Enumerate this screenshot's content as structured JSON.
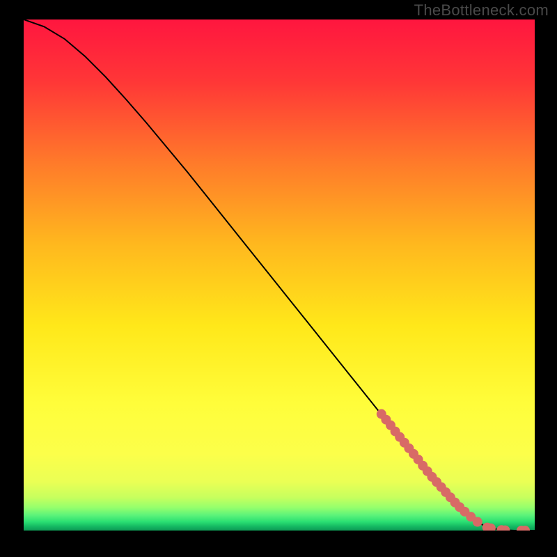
{
  "watermark": "TheBottleneck.com",
  "chart_data": {
    "type": "line",
    "title": "",
    "xlabel": "",
    "ylabel": "",
    "xlim": [
      0,
      100
    ],
    "ylim": [
      0,
      100
    ],
    "grid": false,
    "background_gradient": [
      "#ff163f",
      "#ff6d2d",
      "#ffb81e",
      "#ffe81a",
      "#fffd3a",
      "#d3ff4f",
      "#6bff7a",
      "#1fd66a",
      "#0ea055"
    ],
    "series": [
      {
        "name": "curve",
        "type": "line",
        "x": [
          0,
          4,
          8,
          12,
          16,
          20,
          24,
          28,
          32,
          36,
          40,
          44,
          48,
          52,
          56,
          60,
          64,
          68,
          72,
          76,
          80,
          84,
          86,
          88,
          90,
          92,
          94,
          96,
          98,
          100
        ],
        "y": [
          100.0,
          98.6,
          96.2,
          92.8,
          88.8,
          84.4,
          79.8,
          75.0,
          70.2,
          65.2,
          60.2,
          55.2,
          50.2,
          45.2,
          40.2,
          35.2,
          30.2,
          25.2,
          20.2,
          15.2,
          10.4,
          5.8,
          3.8,
          2.2,
          1.0,
          0.35,
          0.1,
          0.0,
          0.0,
          0.0
        ],
        "stroke": "#000000",
        "stroke_width": 2
      },
      {
        "name": "markers",
        "type": "scatter",
        "x": [
          70.0,
          70.9,
          71.8,
          72.7,
          73.6,
          74.5,
          75.4,
          76.3,
          77.2,
          78.1,
          79.0,
          79.9,
          80.8,
          81.7,
          82.6,
          83.5,
          84.4,
          85.3,
          86.3,
          87.5,
          88.8,
          90.7,
          91.4,
          93.5,
          94.2,
          97.4,
          98.1
        ],
        "y": [
          22.8,
          21.7,
          20.6,
          19.4,
          18.3,
          17.2,
          16.1,
          15.0,
          13.9,
          12.7,
          11.6,
          10.5,
          9.5,
          8.5,
          7.5,
          6.5,
          5.5,
          4.6,
          3.7,
          2.7,
          1.7,
          0.6,
          0.45,
          0.1,
          0.05,
          0.0,
          0.0
        ],
        "marker_color": "#d86a66",
        "marker_radius": 7
      }
    ]
  }
}
